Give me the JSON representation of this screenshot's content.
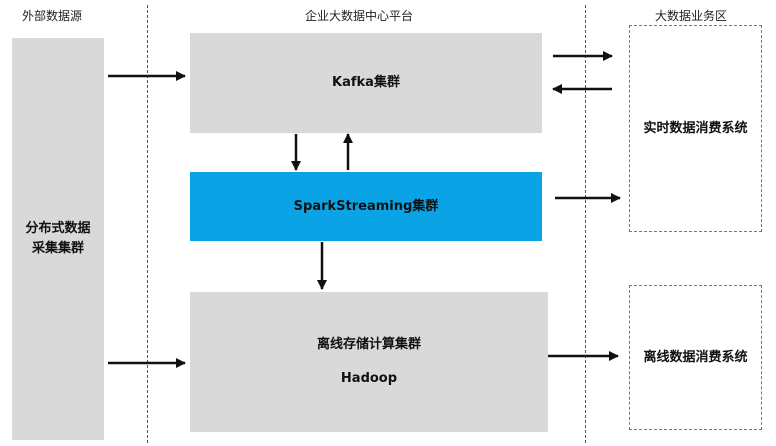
{
  "headers": {
    "external": "外部数据源",
    "platform": "企业大数据中心平台",
    "business": "大数据业务区"
  },
  "boxes": {
    "collector_line1": "分布式数据",
    "collector_line2": "采集集群",
    "kafka": "Kafka集群",
    "spark": "SparkStreaming集群",
    "offline_title": "离线存储计算集群",
    "offline_sub": "Hadoop",
    "realtime_system": "实时数据消费系统",
    "offline_system": "离线数据消费系统"
  },
  "colors": {
    "gray_box": "#d9d9d9",
    "spark_box": "#0aa3e6",
    "arrow": "#111111"
  }
}
